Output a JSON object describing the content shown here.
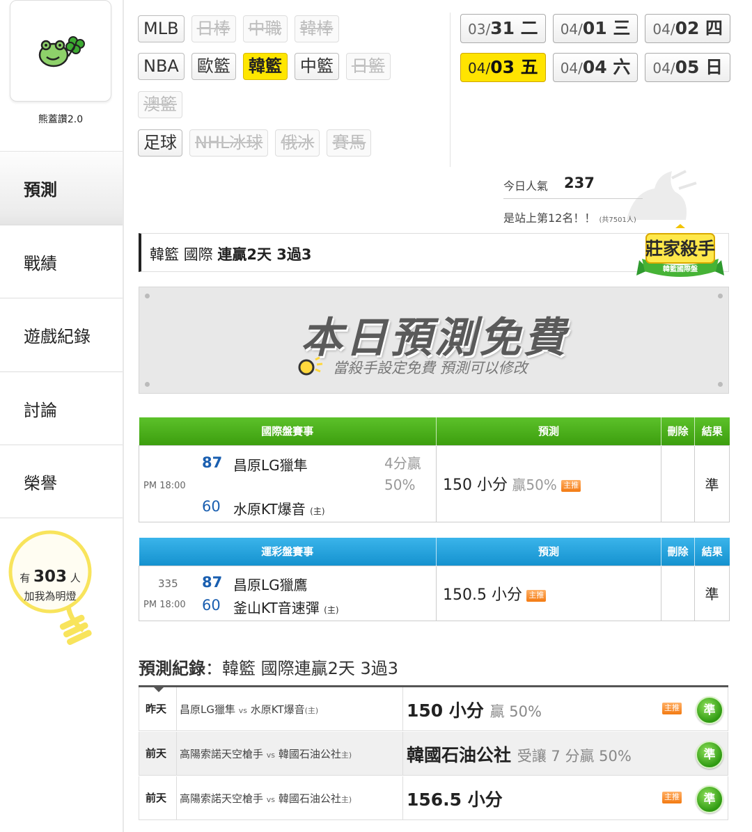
{
  "sidebar": {
    "username": "熊蓋讚2.0",
    "nav": [
      {
        "label": "預測",
        "active": true
      },
      {
        "label": "戰績",
        "active": false
      },
      {
        "label": "遊戲紀錄",
        "active": false
      },
      {
        "label": "討論",
        "active": false
      },
      {
        "label": "榮譽",
        "active": false
      }
    ],
    "bulb": {
      "prefix": "有",
      "count": "303",
      "suffix": "人",
      "line2": "加我為明燈"
    }
  },
  "sports": {
    "row1": [
      {
        "label": "MLB",
        "state": "enabled"
      },
      {
        "label": "日棒",
        "state": "disabled"
      },
      {
        "label": "中職",
        "state": "disabled"
      },
      {
        "label": "韓棒",
        "state": "disabled"
      }
    ],
    "row2": [
      {
        "label": "NBA",
        "state": "enabled"
      },
      {
        "label": "歐籃",
        "state": "enabled"
      },
      {
        "label": "韓籃",
        "state": "selected"
      },
      {
        "label": "中籃",
        "state": "enabled"
      },
      {
        "label": "日籃",
        "state": "disabled"
      }
    ],
    "row3": [
      {
        "label": "澳籃",
        "state": "disabled"
      }
    ],
    "row4": [
      {
        "label": "足球",
        "state": "enabled"
      },
      {
        "label": "NHL冰球",
        "state": "disabled"
      },
      {
        "label": "俄冰",
        "state": "disabled"
      },
      {
        "label": "賽馬",
        "state": "disabled"
      }
    ]
  },
  "dates": {
    "row1": [
      {
        "month": "03/",
        "day": "31 二",
        "selected": false
      },
      {
        "month": "04/",
        "day": "01 三",
        "selected": false
      },
      {
        "month": "04/",
        "day": "02 四",
        "selected": false
      }
    ],
    "row2": [
      {
        "month": "04/",
        "day": "03 五",
        "selected": true
      },
      {
        "month": "04/",
        "day": "04 六",
        "selected": false
      },
      {
        "month": "04/",
        "day": "05 日",
        "selected": false
      }
    ]
  },
  "popularity": {
    "label": "今日人氣",
    "value": "237",
    "rank_text": "是站上第12名！！",
    "rank_total": "(共7501人)"
  },
  "title_bar": {
    "league": "韓籃",
    "type": "國際",
    "streak": "連贏2天 3過3"
  },
  "killer_badge": {
    "title": "莊家殺手",
    "sub": "韓籃國際盤"
  },
  "banner": {
    "headline": "本日預測免費",
    "sub": "當殺手設定免費 預測可以修改"
  },
  "intl_table": {
    "headers": {
      "event": "國際盤賽事",
      "pick": "預測",
      "del": "刪除",
      "result": "結果"
    },
    "row": {
      "time": "PM 18:00",
      "score_a": "87",
      "team_a": "昌原LG獵隼",
      "score_b": "60",
      "team_b": "水原KT爆音",
      "home_mark": "(主)",
      "handicap_line1": "4分贏",
      "handicap_line2": "50%",
      "pick": "150 小分",
      "pick_win": "贏50%",
      "tag": "主推",
      "result": "準"
    }
  },
  "lott_table": {
    "headers": {
      "event": "運彩盤賽事",
      "pick": "預測",
      "del": "刪除",
      "result": "結果"
    },
    "row": {
      "game_no": "335",
      "time": "PM 18:00",
      "score_a": "87",
      "team_a": "昌原LG獵鷹",
      "score_b": "60",
      "team_b": "釜山KT音速彈",
      "home_mark": "(主)",
      "pick": "150.5 小分",
      "tag": "主推",
      "result": "準"
    }
  },
  "record": {
    "title_bold": "預測紀錄",
    "title_rest": "：韓籃 國際連贏2天 3過3",
    "rows": [
      {
        "day": "昨天",
        "team_a": "昌原LG獵隼",
        "vs": "vs",
        "team_b": "水原KT爆音",
        "home": "(主)",
        "pick": "150 小分",
        "pick_note": "贏 50%",
        "tag": "主推",
        "result": "準"
      },
      {
        "day": "前天",
        "team_a": "高陽索諾天空槍手",
        "vs": "vs",
        "team_b": "韓國石油公社",
        "home": "主)",
        "pick": "韓國石油公社",
        "pick_note": "受讓 7 分贏 50%",
        "tag": "",
        "result": "準"
      },
      {
        "day": "前天",
        "team_a": "高陽索諾天空槍手",
        "vs": "vs",
        "team_b": "韓國石油公社",
        "home": "主)",
        "pick": "156.5 小分",
        "pick_note": "",
        "tag": "主推",
        "result": "準"
      }
    ]
  },
  "colors": {
    "selected": "#ffe600",
    "intl_header": "#4bb01c",
    "lott_header": "#22a2dc",
    "accurate": "#1d9a1d",
    "tag": "#f37a12"
  }
}
